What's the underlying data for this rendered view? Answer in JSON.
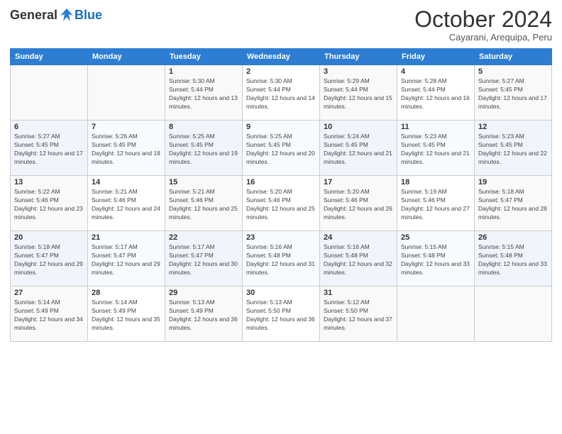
{
  "header": {
    "logo_general": "General",
    "logo_blue": "Blue",
    "month_title": "October 2024",
    "subtitle": "Cayarani, Arequipa, Peru"
  },
  "days_of_week": [
    "Sunday",
    "Monday",
    "Tuesday",
    "Wednesday",
    "Thursday",
    "Friday",
    "Saturday"
  ],
  "weeks": [
    [
      {
        "day": "",
        "sunrise": "",
        "sunset": "",
        "daylight": ""
      },
      {
        "day": "",
        "sunrise": "",
        "sunset": "",
        "daylight": ""
      },
      {
        "day": "1",
        "sunrise": "Sunrise: 5:30 AM",
        "sunset": "Sunset: 5:44 PM",
        "daylight": "Daylight: 12 hours and 13 minutes."
      },
      {
        "day": "2",
        "sunrise": "Sunrise: 5:30 AM",
        "sunset": "Sunset: 5:44 PM",
        "daylight": "Daylight: 12 hours and 14 minutes."
      },
      {
        "day": "3",
        "sunrise": "Sunrise: 5:29 AM",
        "sunset": "Sunset: 5:44 PM",
        "daylight": "Daylight: 12 hours and 15 minutes."
      },
      {
        "day": "4",
        "sunrise": "Sunrise: 5:28 AM",
        "sunset": "Sunset: 5:44 PM",
        "daylight": "Daylight: 12 hours and 16 minutes."
      },
      {
        "day": "5",
        "sunrise": "Sunrise: 5:27 AM",
        "sunset": "Sunset: 5:45 PM",
        "daylight": "Daylight: 12 hours and 17 minutes."
      }
    ],
    [
      {
        "day": "6",
        "sunrise": "Sunrise: 5:27 AM",
        "sunset": "Sunset: 5:45 PM",
        "daylight": "Daylight: 12 hours and 17 minutes."
      },
      {
        "day": "7",
        "sunrise": "Sunrise: 5:26 AM",
        "sunset": "Sunset: 5:45 PM",
        "daylight": "Daylight: 12 hours and 18 minutes."
      },
      {
        "day": "8",
        "sunrise": "Sunrise: 5:25 AM",
        "sunset": "Sunset: 5:45 PM",
        "daylight": "Daylight: 12 hours and 19 minutes."
      },
      {
        "day": "9",
        "sunrise": "Sunrise: 5:25 AM",
        "sunset": "Sunset: 5:45 PM",
        "daylight": "Daylight: 12 hours and 20 minutes."
      },
      {
        "day": "10",
        "sunrise": "Sunrise: 5:24 AM",
        "sunset": "Sunset: 5:45 PM",
        "daylight": "Daylight: 12 hours and 21 minutes."
      },
      {
        "day": "11",
        "sunrise": "Sunrise: 5:23 AM",
        "sunset": "Sunset: 5:45 PM",
        "daylight": "Daylight: 12 hours and 21 minutes."
      },
      {
        "day": "12",
        "sunrise": "Sunrise: 5:23 AM",
        "sunset": "Sunset: 5:45 PM",
        "daylight": "Daylight: 12 hours and 22 minutes."
      }
    ],
    [
      {
        "day": "13",
        "sunrise": "Sunrise: 5:22 AM",
        "sunset": "Sunset: 5:46 PM",
        "daylight": "Daylight: 12 hours and 23 minutes."
      },
      {
        "day": "14",
        "sunrise": "Sunrise: 5:21 AM",
        "sunset": "Sunset: 5:46 PM",
        "daylight": "Daylight: 12 hours and 24 minutes."
      },
      {
        "day": "15",
        "sunrise": "Sunrise: 5:21 AM",
        "sunset": "Sunset: 5:46 PM",
        "daylight": "Daylight: 12 hours and 25 minutes."
      },
      {
        "day": "16",
        "sunrise": "Sunrise: 5:20 AM",
        "sunset": "Sunset: 5:46 PM",
        "daylight": "Daylight: 12 hours and 25 minutes."
      },
      {
        "day": "17",
        "sunrise": "Sunrise: 5:20 AM",
        "sunset": "Sunset: 5:46 PM",
        "daylight": "Daylight: 12 hours and 26 minutes."
      },
      {
        "day": "18",
        "sunrise": "Sunrise: 5:19 AM",
        "sunset": "Sunset: 5:46 PM",
        "daylight": "Daylight: 12 hours and 27 minutes."
      },
      {
        "day": "19",
        "sunrise": "Sunrise: 5:18 AM",
        "sunset": "Sunset: 5:47 PM",
        "daylight": "Daylight: 12 hours and 28 minutes."
      }
    ],
    [
      {
        "day": "20",
        "sunrise": "Sunrise: 5:18 AM",
        "sunset": "Sunset: 5:47 PM",
        "daylight": "Daylight: 12 hours and 29 minutes."
      },
      {
        "day": "21",
        "sunrise": "Sunrise: 5:17 AM",
        "sunset": "Sunset: 5:47 PM",
        "daylight": "Daylight: 12 hours and 29 minutes."
      },
      {
        "day": "22",
        "sunrise": "Sunrise: 5:17 AM",
        "sunset": "Sunset: 5:47 PM",
        "daylight": "Daylight: 12 hours and 30 minutes."
      },
      {
        "day": "23",
        "sunrise": "Sunrise: 5:16 AM",
        "sunset": "Sunset: 5:48 PM",
        "daylight": "Daylight: 12 hours and 31 minutes."
      },
      {
        "day": "24",
        "sunrise": "Sunrise: 5:16 AM",
        "sunset": "Sunset: 5:48 PM",
        "daylight": "Daylight: 12 hours and 32 minutes."
      },
      {
        "day": "25",
        "sunrise": "Sunrise: 5:15 AM",
        "sunset": "Sunset: 5:48 PM",
        "daylight": "Daylight: 12 hours and 33 minutes."
      },
      {
        "day": "26",
        "sunrise": "Sunrise: 5:15 AM",
        "sunset": "Sunset: 5:48 PM",
        "daylight": "Daylight: 12 hours and 33 minutes."
      }
    ],
    [
      {
        "day": "27",
        "sunrise": "Sunrise: 5:14 AM",
        "sunset": "Sunset: 5:49 PM",
        "daylight": "Daylight: 12 hours and 34 minutes."
      },
      {
        "day": "28",
        "sunrise": "Sunrise: 5:14 AM",
        "sunset": "Sunset: 5:49 PM",
        "daylight": "Daylight: 12 hours and 35 minutes."
      },
      {
        "day": "29",
        "sunrise": "Sunrise: 5:13 AM",
        "sunset": "Sunset: 5:49 PM",
        "daylight": "Daylight: 12 hours and 36 minutes."
      },
      {
        "day": "30",
        "sunrise": "Sunrise: 5:13 AM",
        "sunset": "Sunset: 5:50 PM",
        "daylight": "Daylight: 12 hours and 36 minutes."
      },
      {
        "day": "31",
        "sunrise": "Sunrise: 5:12 AM",
        "sunset": "Sunset: 5:50 PM",
        "daylight": "Daylight: 12 hours and 37 minutes."
      },
      {
        "day": "",
        "sunrise": "",
        "sunset": "",
        "daylight": ""
      },
      {
        "day": "",
        "sunrise": "",
        "sunset": "",
        "daylight": ""
      }
    ]
  ]
}
